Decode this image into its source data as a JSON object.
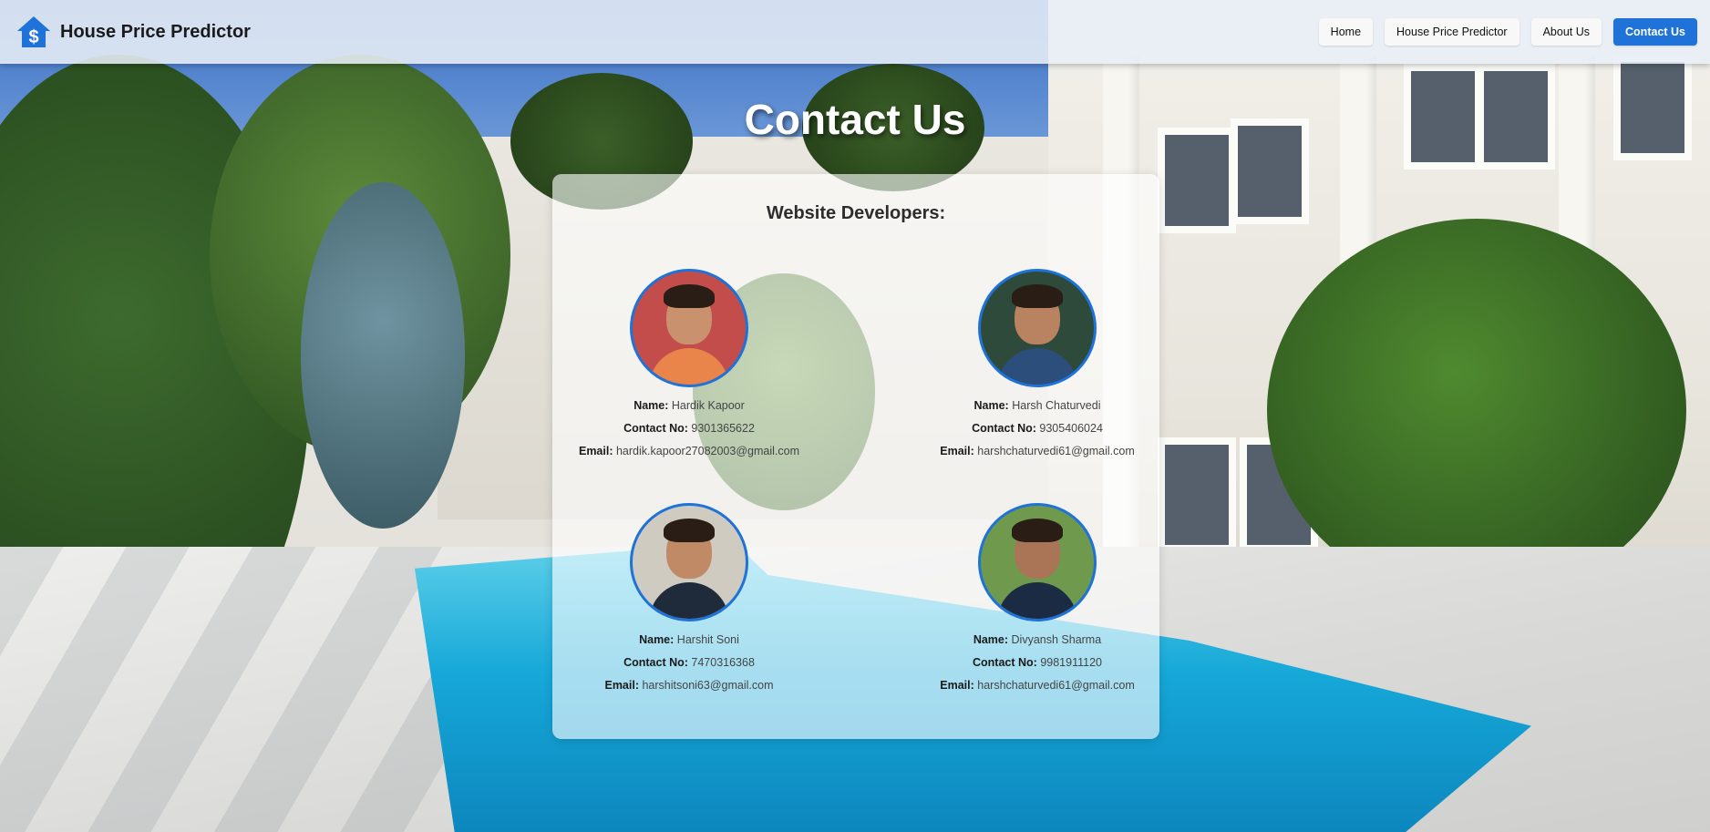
{
  "app": {
    "title": "House Price Predictor",
    "brand_icon": "house-dollar-icon"
  },
  "nav": {
    "items": [
      {
        "label": "Home",
        "active": false
      },
      {
        "label": "House Price Predictor",
        "active": false
      },
      {
        "label": "About Us",
        "active": false
      },
      {
        "label": "Contact Us",
        "active": true
      }
    ]
  },
  "page": {
    "title": "Contact Us",
    "section_heading": "Website Developers:"
  },
  "labels": {
    "name": "Name:",
    "contact": "Contact No:",
    "email": "Email:"
  },
  "developers": [
    {
      "name": "Hardik Kapoor",
      "contact": "9301365622",
      "email": "hardik.kapoor27082003@gmail.com",
      "photo_icon": "developer-avatar"
    },
    {
      "name": "Harsh Chaturvedi",
      "contact": "9305406024",
      "email": "harshchaturvedi61@gmail.com",
      "photo_icon": "developer-avatar"
    },
    {
      "name": "Harshit Soni",
      "contact": "7470316368",
      "email": "harshitsoni63@gmail.com",
      "photo_icon": "developer-avatar"
    },
    {
      "name": "Divyansh Sharma",
      "contact": "9981911120",
      "email": "harshchaturvedi61@gmail.com",
      "photo_icon": "developer-avatar"
    }
  ],
  "colors": {
    "accent": "#1e72d8",
    "navbar_bg": "#e8eef6"
  }
}
